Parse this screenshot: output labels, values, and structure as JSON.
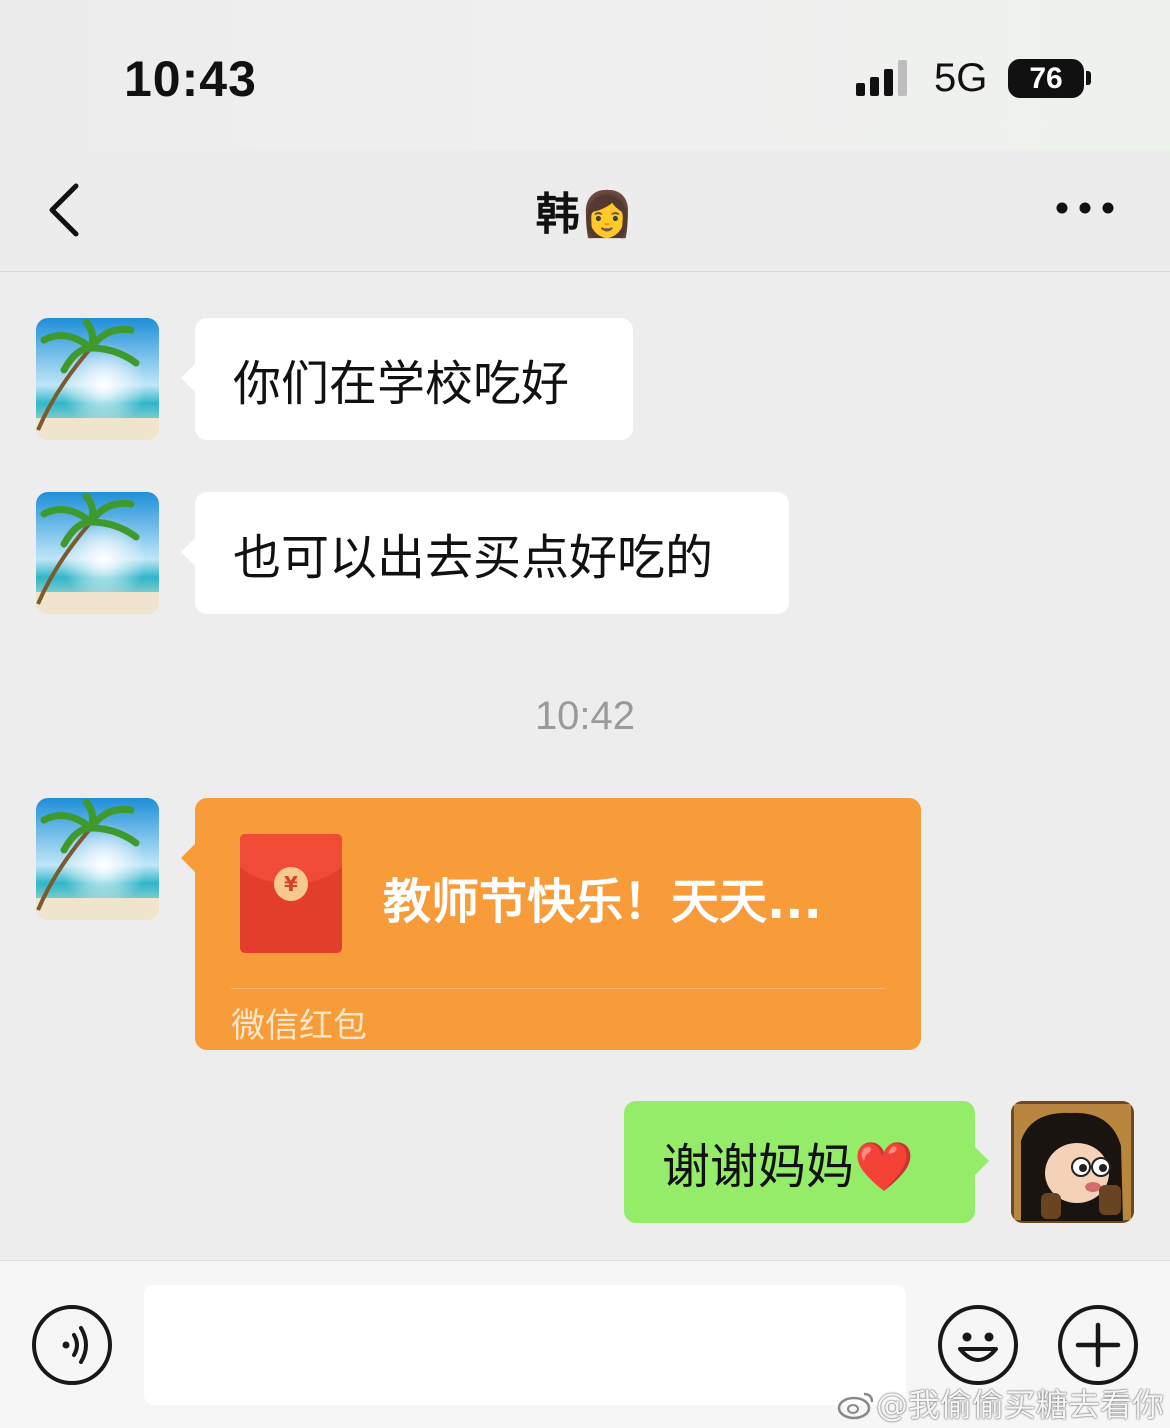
{
  "status_bar": {
    "time": "10:43",
    "network": "5G",
    "battery": "76"
  },
  "nav": {
    "title": "韩👩"
  },
  "messages": [
    {
      "side": "left",
      "text": "你们在学校吃好"
    },
    {
      "side": "left",
      "text": "也可以出去买点好吃的"
    }
  ],
  "timestamp": "10:42",
  "red_packet": {
    "message": "教师节快乐！天天...",
    "label": "微信红包",
    "coin_symbol": "¥",
    "color": "#f79c39"
  },
  "reply": {
    "side": "right",
    "text": "谢谢妈妈❤️",
    "color": "#95ec69"
  },
  "input": {
    "placeholder": ""
  },
  "watermark": "@我偷偷买糖去看你",
  "icons": [
    "chevron-left-icon",
    "more-icon",
    "voice-icon",
    "emoji-icon",
    "plus-icon",
    "weibo-icon"
  ]
}
